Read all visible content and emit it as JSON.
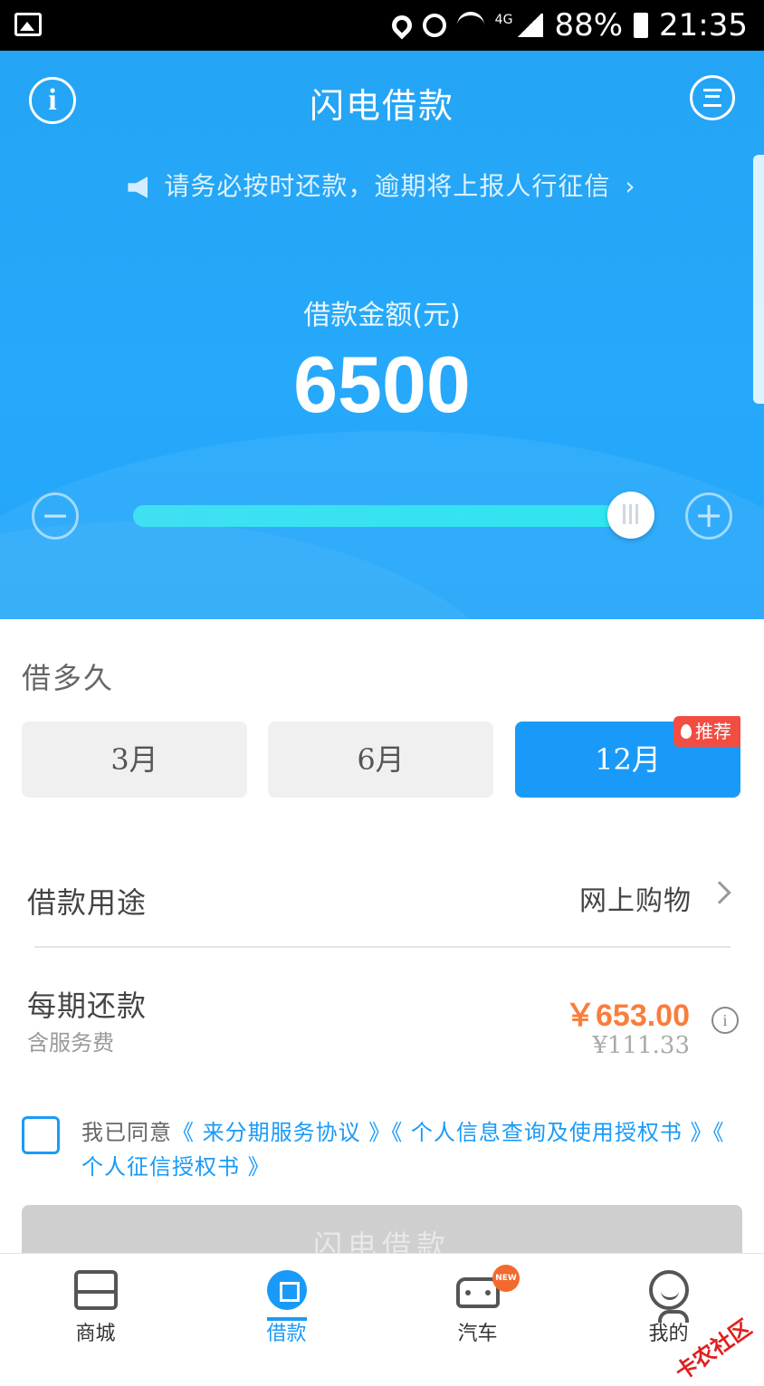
{
  "status_bar": {
    "battery": "88%",
    "time": "21:35",
    "network": "4G"
  },
  "header": {
    "title": "闪电借款",
    "notice": "请务必按时还款，逾期将上报人行征信",
    "notice_chevron": "›"
  },
  "amount": {
    "label": "借款金额(元)",
    "value": "6500",
    "slider_fraction": 1.0,
    "minus_symbol": "−",
    "plus_symbol": "+"
  },
  "term_section": {
    "title": "借多久",
    "options": [
      {
        "label": "3月",
        "selected": false
      },
      {
        "label": "6月",
        "selected": false
      },
      {
        "label": "12月",
        "selected": true
      }
    ],
    "recommend_badge": "推荐"
  },
  "purpose": {
    "label": "借款用途",
    "value": "网上购物"
  },
  "repayment": {
    "label": "每期还款",
    "sub_label": "含服务费",
    "amount": "￥653.00",
    "original": "¥111.33"
  },
  "agreement": {
    "prefix": "我已同意",
    "links": [
      "《 来分期服务协议 》",
      "《 个人信息查询及使用授权书 》",
      "《 个人征信授权书 》"
    ],
    "checked": false
  },
  "submit": {
    "label": "闪电借款"
  },
  "tabbar": {
    "tabs": [
      {
        "label": "商城",
        "icon": "store-icon",
        "active": false
      },
      {
        "label": "借款",
        "icon": "loan-icon",
        "active": true
      },
      {
        "label": "汽车",
        "icon": "car-icon",
        "active": false,
        "badge": "NEW"
      },
      {
        "label": "我的",
        "icon": "profile-icon",
        "active": false
      }
    ]
  },
  "watermark": "卡农社区",
  "colors": {
    "primary": "#1a9af8",
    "hero": "#26a9fb",
    "accent_orange": "#fa7d3c",
    "badge_red": "#f24d43"
  }
}
